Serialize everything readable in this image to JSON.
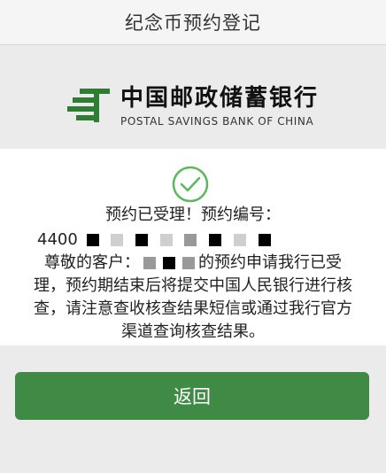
{
  "header": {
    "title": "纪念币预约登记"
  },
  "logo": {
    "name_cn": "中国邮政储蓄银行",
    "name_en": "POSTAL SAVINGS BANK OF CHINA",
    "icon": "postal-bank-logo-icon",
    "color": "#2e7d32"
  },
  "result": {
    "icon": "check-circle-icon",
    "icon_color": "#5cb85c",
    "line1": "预约已受理！预约编号：",
    "number_prefix": "4400",
    "greeting_prefix": "尊敬的客户：",
    "greeting_suffix": "的预约申请我行已受",
    "line4": "理，预约期结束后将提交中国人民银行进行核",
    "line5": "查，请注意查收核查结果短信或通过我行官方",
    "line6": "渠道查询核查结果。"
  },
  "actions": {
    "back_label": "返回",
    "back_color": "#3f8a45"
  }
}
